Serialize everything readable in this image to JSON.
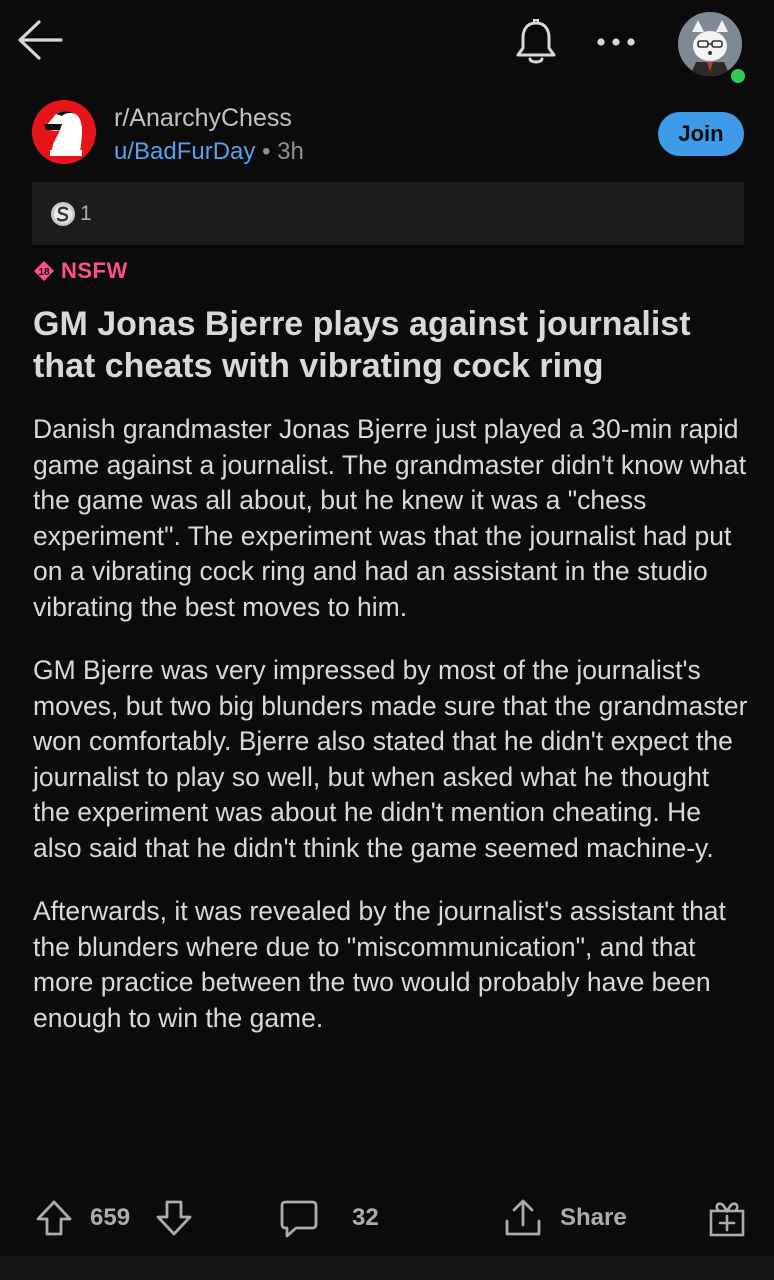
{
  "topbar": {
    "back_icon": "arrow-left-icon",
    "bell_icon": "bell-icon",
    "more_icon": "more-horizontal-icon",
    "avatar_icon": "user-avatar-icon"
  },
  "post": {
    "subreddit": "r/AnarchyChess",
    "author": "u/BadFurDay",
    "separator": "•",
    "age": "3h",
    "join_label": "Join",
    "award_count": "1",
    "nsfw_label": "NSFW",
    "nsfw_badge": "18",
    "title": "GM Jonas Bjerre plays against journalist that cheats with vibrating cock ring",
    "paragraphs": [
      "Danish grandmaster Jonas Bjerre just  played a 30-min rapid game against a journalist. The grandmaster didn't  know what the game was all about, but he knew it was a \"chess  experiment\". The experiment was that the journalist had put on a vibrating cock ring and had an assistant in the studio vibrating the  best moves to him.",
      "GM Bjerre was  very impressed by most of the journalist's moves, but two big blunders  made sure that the grandmaster won comfortably. Bjerre also stated that  he didn't expect the journalist to play so well, but when asked what he  thought the experiment was about he didn't mention cheating. He also  said that he didn't think the game seemed machine-y.",
      "Afterwards,  it was revealed by the journalist's assistant that the blunders where  due to \"miscommunication\", and that more practice between the two would  probably have been enough to win the game."
    ]
  },
  "actions": {
    "vote_count": "659",
    "comment_count": "32",
    "share_label": "Share",
    "upvote_icon": "arrow-up-outline-icon",
    "downvote_icon": "arrow-down-outline-icon",
    "comment_icon": "comment-bubble-icon",
    "share_icon": "share-upload-icon",
    "award_icon": "gift-award-icon"
  },
  "colors": {
    "background": "#0b0b0b",
    "accent_blue": "#3d9be9",
    "nsfw_pink": "#ff4f8b",
    "subreddit_red": "#e4141a"
  }
}
